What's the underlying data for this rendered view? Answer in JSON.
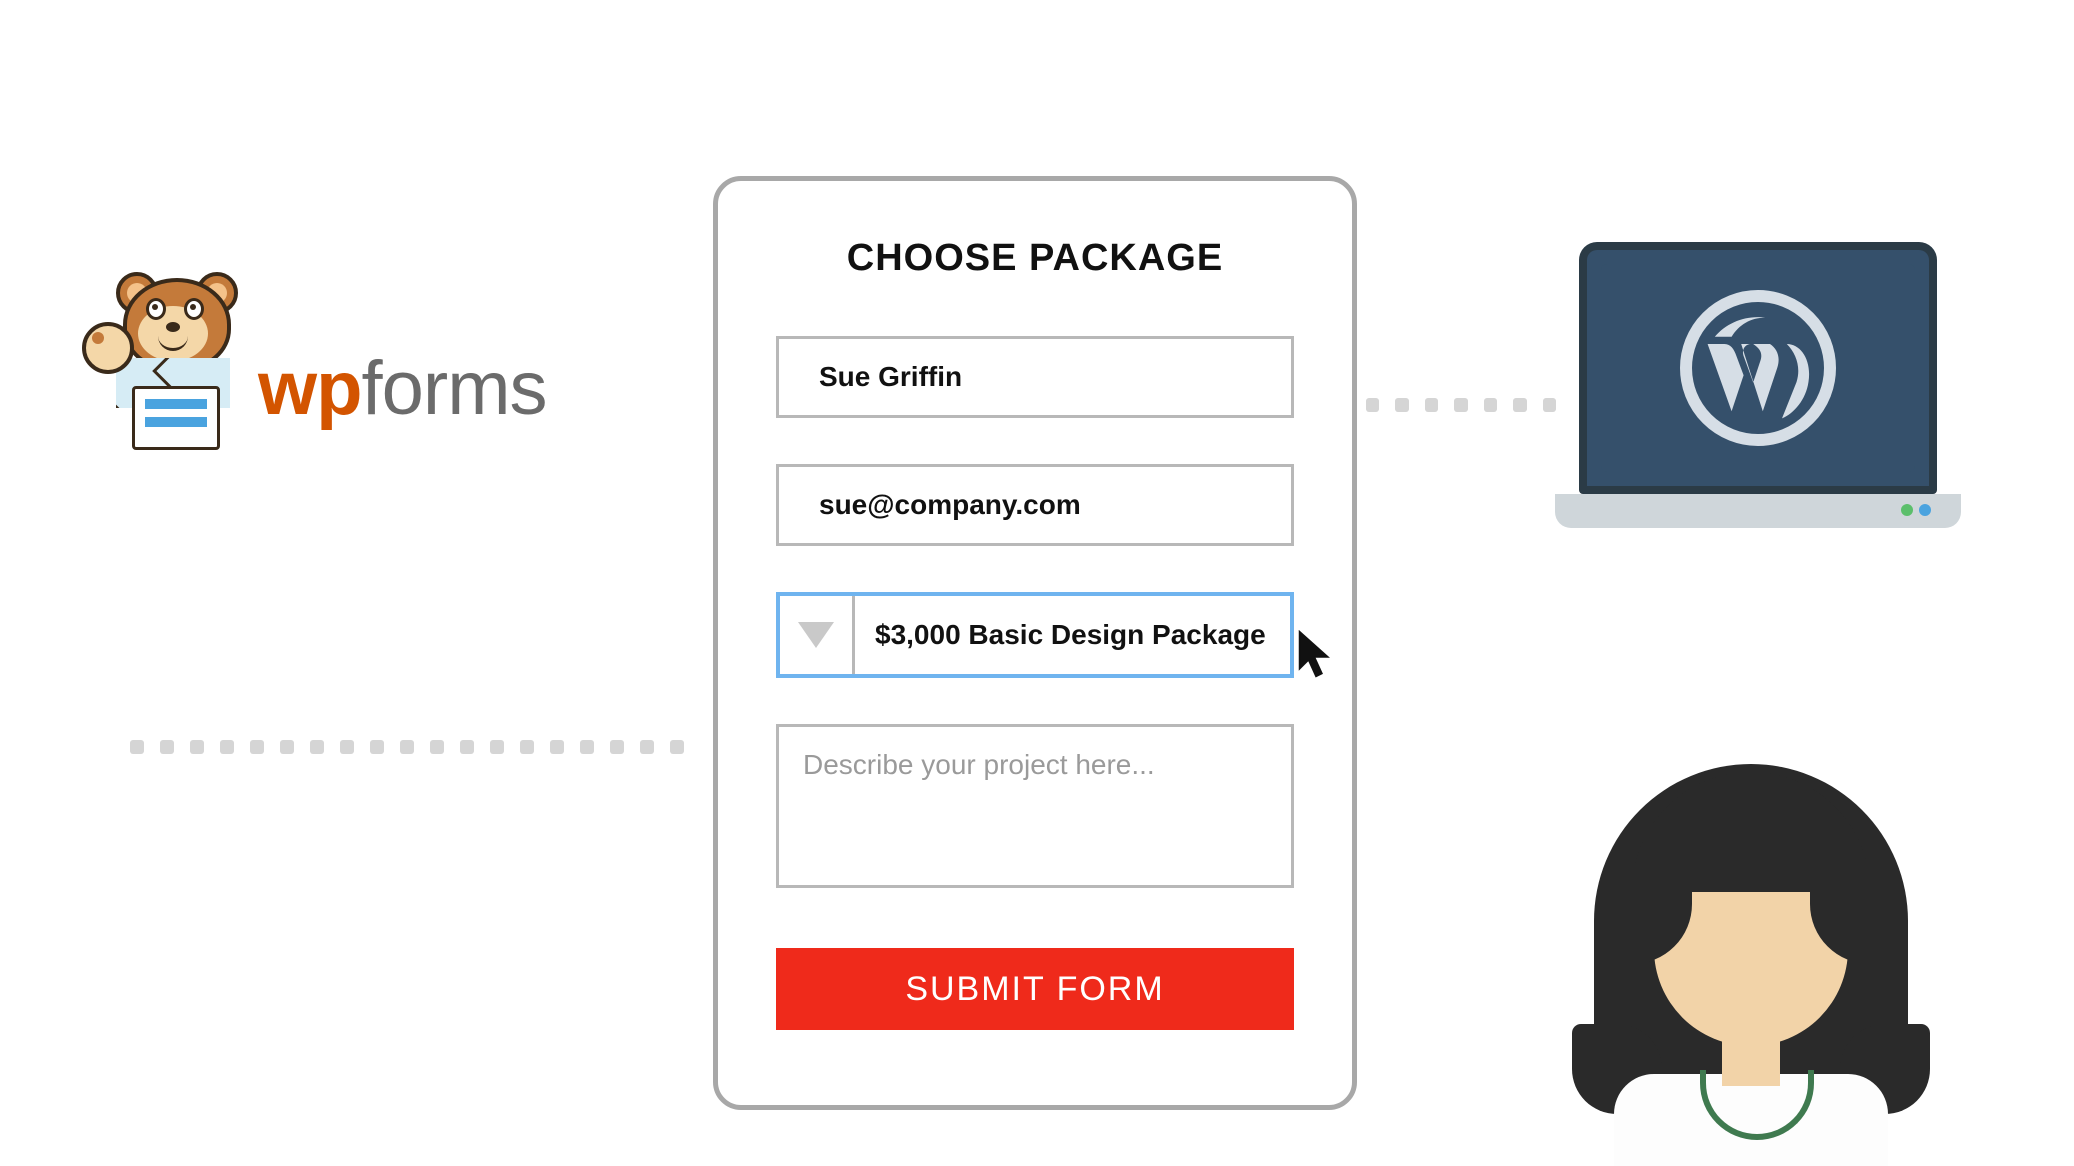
{
  "logo": {
    "brand_part1": "wp",
    "brand_part2": "forms"
  },
  "form": {
    "title": "CHOOSE PACKAGE",
    "name_value": "Sue Griffin",
    "email_value": "sue@company.com",
    "package_selected": "$3,000 Basic Design Package",
    "description_placeholder": "Describe your project here...",
    "submit_label": "SUBMIT FORM"
  },
  "icons": {
    "laptop": "wordpress-logo",
    "mascot": "wpforms-bear",
    "avatar": "woman-avatar"
  }
}
